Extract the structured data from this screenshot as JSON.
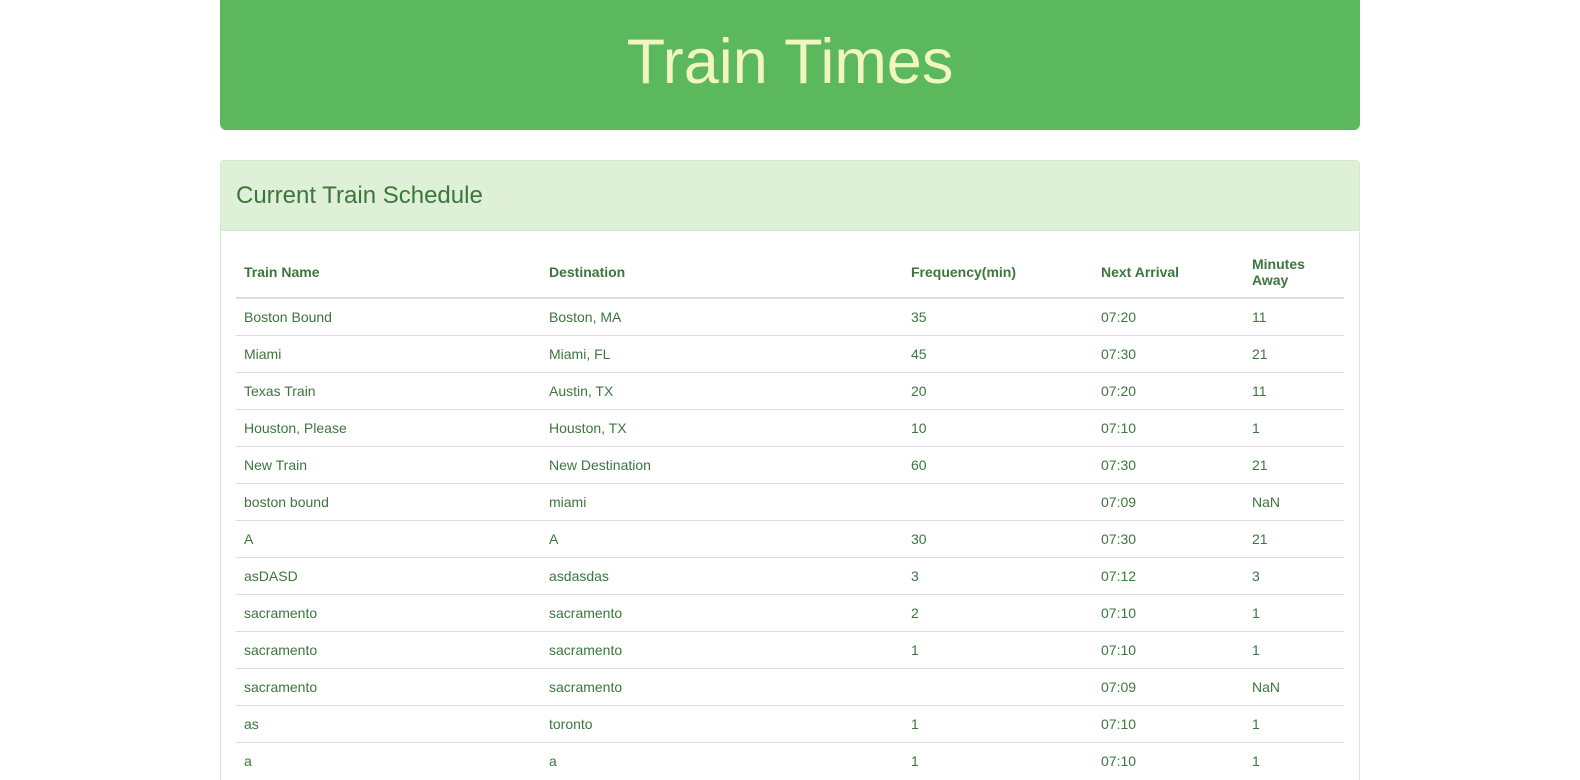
{
  "header": {
    "title": "Train Times"
  },
  "schedule": {
    "title": "Current Train Schedule",
    "columns": [
      "Train Name",
      "Destination",
      "Frequency(min)",
      "Next Arrival",
      "Minutes Away"
    ],
    "rows": [
      {
        "name": "Boston Bound",
        "destination": "Boston, MA",
        "frequency": "35",
        "next_arrival": "07:20",
        "minutes_away": "11"
      },
      {
        "name": "Miami",
        "destination": "Miami, FL",
        "frequency": "45",
        "next_arrival": "07:30",
        "minutes_away": "21"
      },
      {
        "name": "Texas Train",
        "destination": "Austin, TX",
        "frequency": "20",
        "next_arrival": "07:20",
        "minutes_away": "11"
      },
      {
        "name": "Houston, Please",
        "destination": "Houston, TX",
        "frequency": "10",
        "next_arrival": "07:10",
        "minutes_away": "1"
      },
      {
        "name": "New Train",
        "destination": "New Destination",
        "frequency": "60",
        "next_arrival": "07:30",
        "minutes_away": "21"
      },
      {
        "name": "boston bound",
        "destination": "miami",
        "frequency": "",
        "next_arrival": "07:09",
        "minutes_away": "NaN"
      },
      {
        "name": "A",
        "destination": "A",
        "frequency": "30",
        "next_arrival": "07:30",
        "minutes_away": "21"
      },
      {
        "name": "asDASD",
        "destination": "asdasdas",
        "frequency": "3",
        "next_arrival": "07:12",
        "minutes_away": "3"
      },
      {
        "name": "sacramento",
        "destination": "sacramento",
        "frequency": "2",
        "next_arrival": "07:10",
        "minutes_away": "1"
      },
      {
        "name": "sacramento",
        "destination": "sacramento",
        "frequency": "1",
        "next_arrival": "07:10",
        "minutes_away": "1"
      },
      {
        "name": "sacramento",
        "destination": "sacramento",
        "frequency": "",
        "next_arrival": "07:09",
        "minutes_away": "NaN"
      },
      {
        "name": "as",
        "destination": "toronto",
        "frequency": "1",
        "next_arrival": "07:10",
        "minutes_away": "1"
      },
      {
        "name": "a",
        "destination": "a",
        "frequency": "1",
        "next_arrival": "07:10",
        "minutes_away": "1"
      }
    ]
  },
  "colors": {
    "header_bg": "#5cb85c",
    "header_text": "#f1f5c0",
    "panel_heading_bg": "#dff0d8",
    "text": "#3c763d"
  }
}
